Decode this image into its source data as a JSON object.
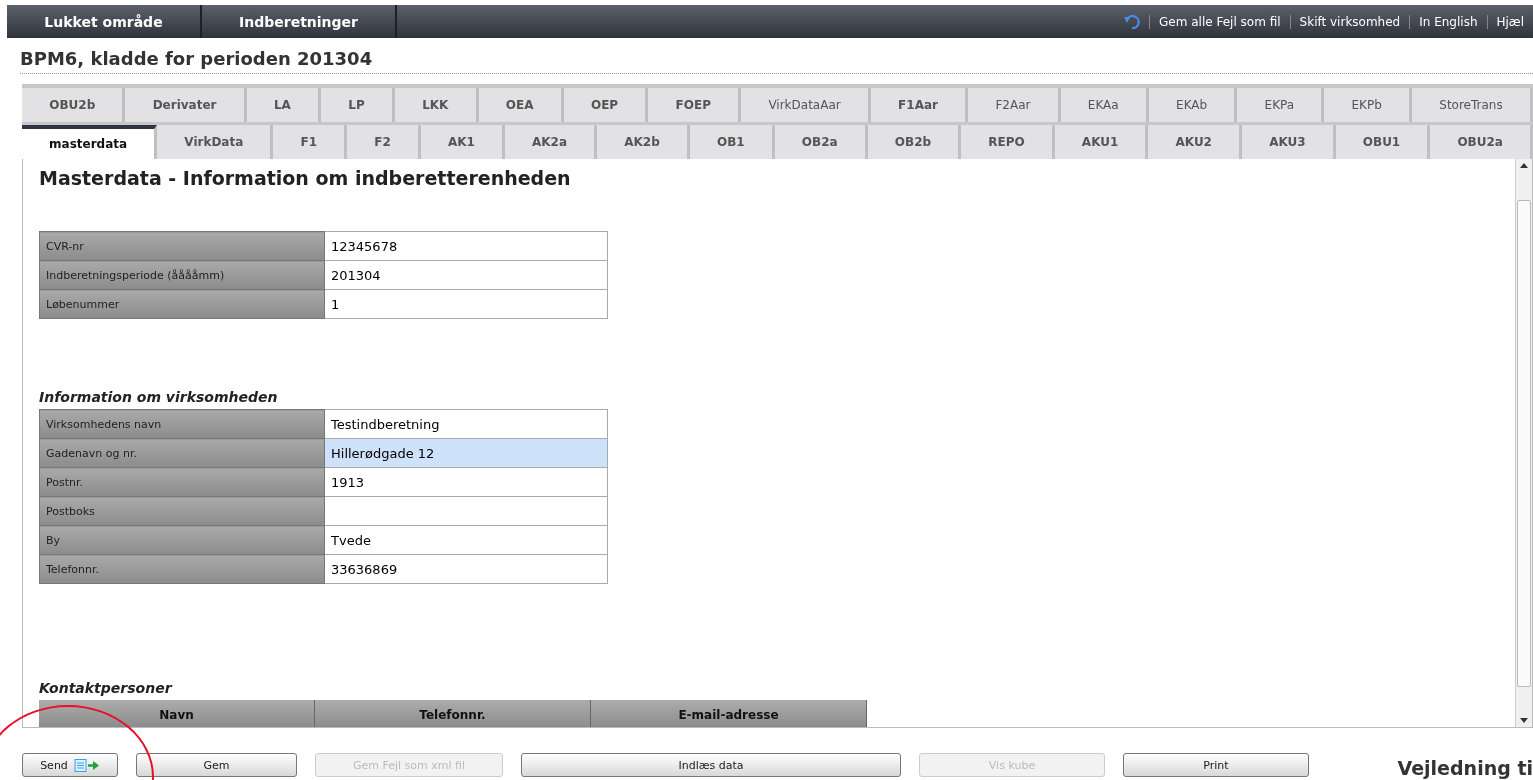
{
  "topbar": {
    "menu": [
      "Lukket område",
      "Indberetninger"
    ],
    "links": [
      "Gem alle Fejl som fil",
      "Skift virksomhed",
      "In English",
      "Hjæl"
    ]
  },
  "page_title": "BPM6, kladde for perioden 201304",
  "tab_rows": [
    [
      {
        "label": "OBU2b",
        "bold": true,
        "selected": false
      },
      {
        "label": "Derivater",
        "bold": true,
        "selected": false
      },
      {
        "label": "LA",
        "bold": true,
        "selected": false
      },
      {
        "label": "LP",
        "bold": true,
        "selected": false
      },
      {
        "label": "LKK",
        "bold": true,
        "selected": false
      },
      {
        "label": "OEA",
        "bold": true,
        "selected": false
      },
      {
        "label": "OEP",
        "bold": true,
        "selected": false
      },
      {
        "label": "FOEP",
        "bold": true,
        "selected": false
      },
      {
        "label": "VirkDataAar",
        "bold": false,
        "selected": false
      },
      {
        "label": "F1Aar",
        "bold": true,
        "selected": false
      },
      {
        "label": "F2Aar",
        "bold": false,
        "selected": false
      },
      {
        "label": "EKAa",
        "bold": false,
        "selected": false
      },
      {
        "label": "EKAb",
        "bold": false,
        "selected": false
      },
      {
        "label": "EKPa",
        "bold": false,
        "selected": false
      },
      {
        "label": "EKPb",
        "bold": false,
        "selected": false
      },
      {
        "label": "StoreTrans",
        "bold": false,
        "selected": false
      }
    ],
    [
      {
        "label": "masterdata",
        "bold": true,
        "selected": true
      },
      {
        "label": "VirkData",
        "bold": true,
        "selected": false
      },
      {
        "label": "F1",
        "bold": true,
        "selected": false
      },
      {
        "label": "F2",
        "bold": true,
        "selected": false
      },
      {
        "label": "AK1",
        "bold": true,
        "selected": false
      },
      {
        "label": "AK2a",
        "bold": true,
        "selected": false
      },
      {
        "label": "AK2b",
        "bold": true,
        "selected": false
      },
      {
        "label": "OB1",
        "bold": true,
        "selected": false
      },
      {
        "label": "OB2a",
        "bold": true,
        "selected": false
      },
      {
        "label": "OB2b",
        "bold": true,
        "selected": false
      },
      {
        "label": "REPO",
        "bold": true,
        "selected": false
      },
      {
        "label": "AKU1",
        "bold": true,
        "selected": false
      },
      {
        "label": "AKU2",
        "bold": true,
        "selected": false
      },
      {
        "label": "AKU3",
        "bold": true,
        "selected": false
      },
      {
        "label": "OBU1",
        "bold": true,
        "selected": false
      },
      {
        "label": "OBU2a",
        "bold": true,
        "selected": false
      }
    ]
  ],
  "content": {
    "heading": "Masterdata - Information om indberetterenheden",
    "sections": [
      {
        "fields": [
          {
            "label": "CVR-nr",
            "value": "12345678",
            "focused": false
          },
          {
            "label": "Indberetningsperiode (ååååmm)",
            "value": "201304",
            "focused": false
          },
          {
            "label": "Løbenummer",
            "value": "1",
            "focused": false
          }
        ]
      },
      {
        "title": "Information om virksomheden",
        "fields": [
          {
            "label": "Virksomhedens navn",
            "value": "Testindberetning",
            "focused": false
          },
          {
            "label": "Gadenavn og nr.",
            "value": "Hillerødgade 12",
            "focused": true
          },
          {
            "label": "Postnr.",
            "value": "1913",
            "focused": false
          },
          {
            "label": "Postboks",
            "focused": false
          },
          {
            "label": "By",
            "value": "Tvede",
            "focused": false
          },
          {
            "label": "Telefonnr.",
            "value": "33636869",
            "focused": false
          }
        ]
      }
    ],
    "contacts": {
      "title": "Kontaktpersoner",
      "columns": [
        "Navn",
        "Telefonnr.",
        "E-mail-adresse"
      ]
    }
  },
  "buttons": [
    {
      "label": "Send",
      "disabled": false,
      "kind": "send"
    },
    {
      "label": "Gem",
      "disabled": false,
      "kind": "plain"
    },
    {
      "label": "Gem Fejl som xml fil",
      "disabled": true,
      "kind": "plain"
    },
    {
      "label": "Indlæs data",
      "disabled": false,
      "kind": "plain"
    },
    {
      "label": "Vis kube",
      "disabled": true,
      "kind": "plain"
    },
    {
      "label": "Print",
      "disabled": false,
      "kind": "plain"
    }
  ],
  "guide_heading": "Vejledning ti"
}
